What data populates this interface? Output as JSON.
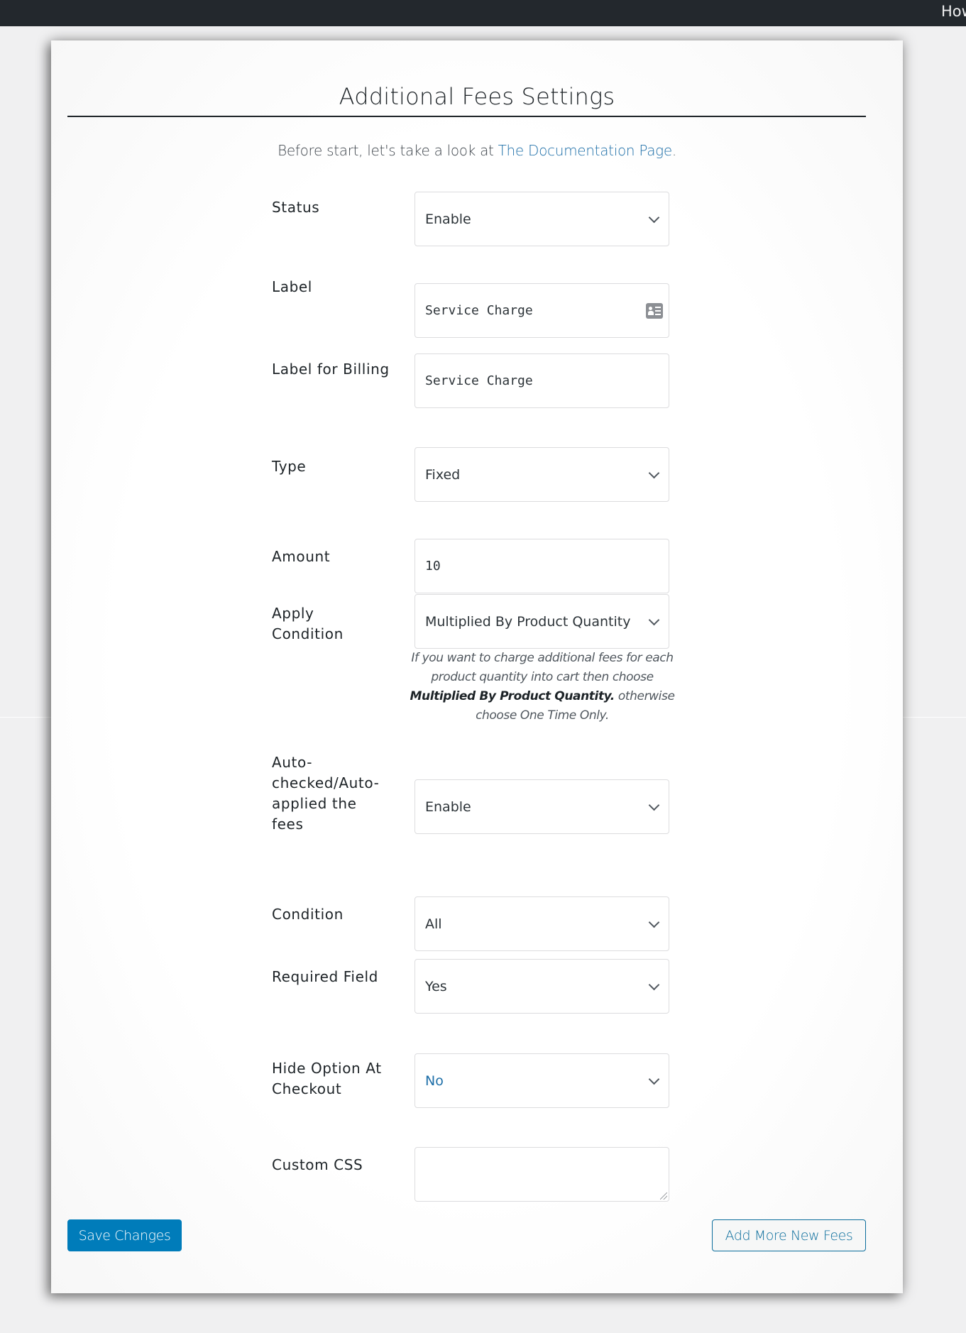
{
  "topbar": {
    "right_text": "How"
  },
  "page": {
    "title": "Additional Fees Settings",
    "intro_text": "Before start, let's take a look at ",
    "intro_link": "The Documentation Page",
    "intro_suffix": "."
  },
  "fields": {
    "status": {
      "label": "Status",
      "value": "Enable",
      "type": "select"
    },
    "label": {
      "label": "Label",
      "value": "Service Charge",
      "type": "text",
      "icon": "contact-card-icon"
    },
    "label_billing": {
      "label": "Label for Billing",
      "value": "Service Charge",
      "type": "text"
    },
    "type": {
      "label": "Type",
      "value": "Fixed",
      "type": "select"
    },
    "amount": {
      "label": "Amount",
      "value": "10",
      "type": "text"
    },
    "apply_condition": {
      "label": "Apply Condition",
      "value": "Multiplied By Product Quantity",
      "type": "select",
      "help_pre": "If you want to charge additional fees for each product quantity into cart then choose ",
      "help_bold": "Multiplied By Product Quantity.",
      "help_post": " otherwise choose One Time Only."
    },
    "auto_applied": {
      "label": "Auto-checked/Auto-applied the fees",
      "value": "Enable",
      "type": "select"
    },
    "condition": {
      "label": "Condition",
      "value": "All",
      "type": "select"
    },
    "required_field": {
      "label": "Required Field",
      "value": "Yes",
      "type": "select"
    },
    "hide_option": {
      "label": "Hide Option At Checkout",
      "value": "No",
      "type": "select"
    },
    "custom_css": {
      "label": "Custom CSS",
      "value": "",
      "type": "textarea"
    }
  },
  "buttons": {
    "save": "Save Changes",
    "add_more": "Add More New Fees"
  },
  "colors": {
    "primary": "#007cba",
    "link": "#1e6fa8",
    "topbar": "#23282d"
  }
}
